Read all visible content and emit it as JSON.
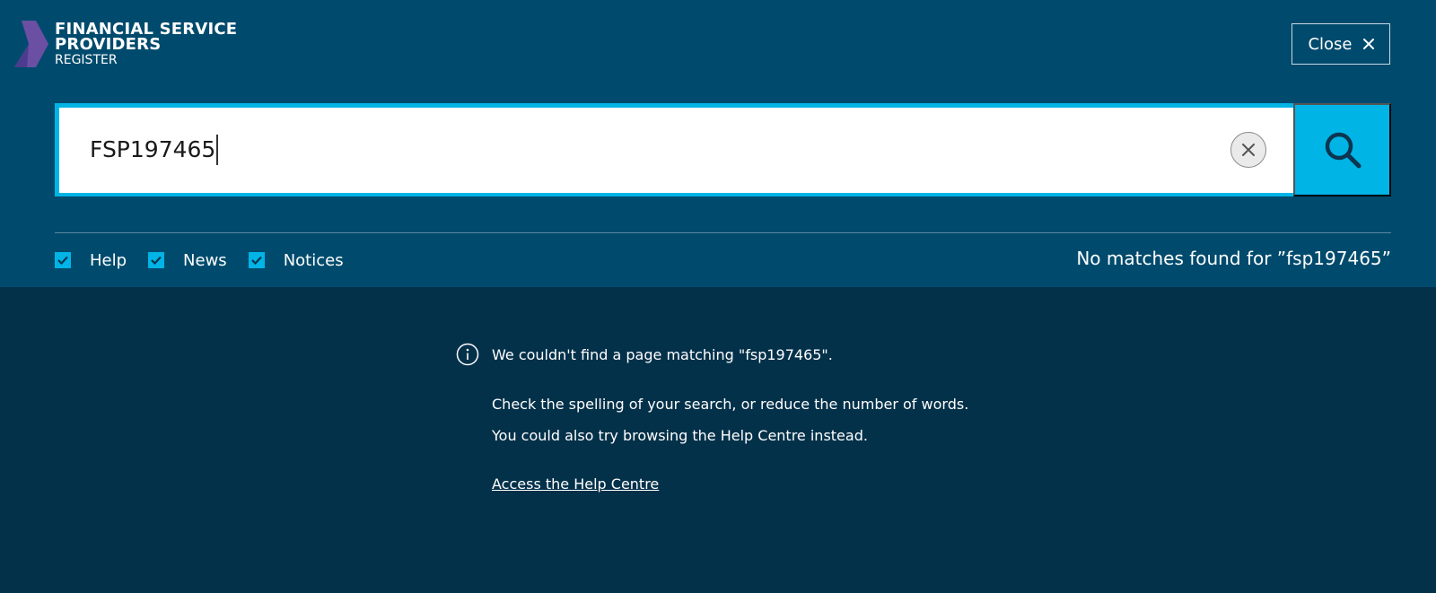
{
  "brand": {
    "line1": "FINANCIAL SERVICE",
    "line2": "PROVIDERS",
    "line3": "REGISTER",
    "chevron_colors": [
      "#6b4fa3",
      "#4a3d8f"
    ]
  },
  "header": {
    "close_label": "Close",
    "close_icon": "close-icon"
  },
  "search": {
    "value": "FSP197465",
    "clear_icon": "clear-icon",
    "submit_icon": "search-icon",
    "accent_color": "#00b4e6"
  },
  "filters": [
    {
      "label": "Help",
      "checked": true
    },
    {
      "label": "News",
      "checked": true
    },
    {
      "label": "Notices",
      "checked": true
    }
  ],
  "results": {
    "summary": "No matches found for ”fsp197465”"
  },
  "message": {
    "icon": "info-icon",
    "line1": "We couldn't find a page matching \"fsp197465\".",
    "line2": "Check the spelling of your search, or reduce the number of words.",
    "line3": "You could also try browsing the Help Centre instead.",
    "link": "Access the Help Centre"
  },
  "colors": {
    "header_bg": "#004b6d",
    "body_bg": "#04314a",
    "accent": "#00b4e6"
  }
}
